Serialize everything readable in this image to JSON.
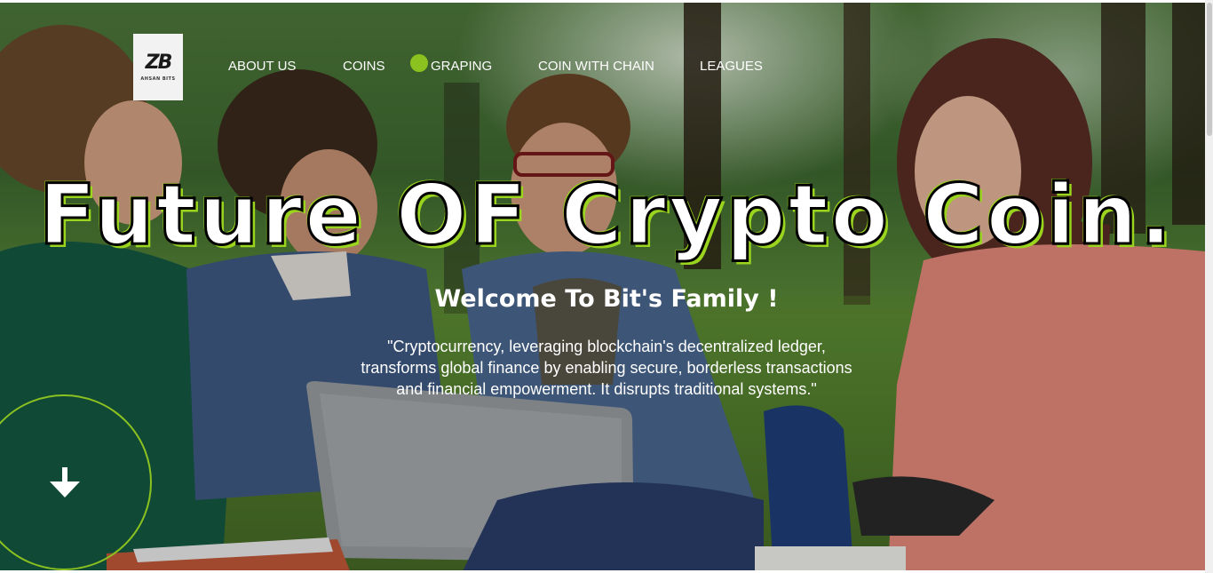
{
  "logo": {
    "mark": "ZB",
    "text": "AHSAN BITS"
  },
  "nav": {
    "items": [
      {
        "label": "ABOUT US"
      },
      {
        "label": "COINS"
      },
      {
        "label": "GRAPING"
      },
      {
        "label": "COIN WITH CHAIN"
      },
      {
        "label": "LEAGUES"
      }
    ],
    "active_indicator_color": "#8cc21f"
  },
  "hero": {
    "title": "Future OF Crypto Coin.",
    "subtitle": "Welcome To Bit's Family !",
    "quote": "\"Cryptocurrency, leveraging blockchain's decentralized ledger, transforms global finance by enabling secure, borderless transactions and financial empowerment. It disrupts traditional systems.\"",
    "accent_color": "#8cc21f",
    "background_image": "students-with-laptop-in-park-photo"
  },
  "scroll_down": {
    "icon": "arrow-down-icon"
  }
}
